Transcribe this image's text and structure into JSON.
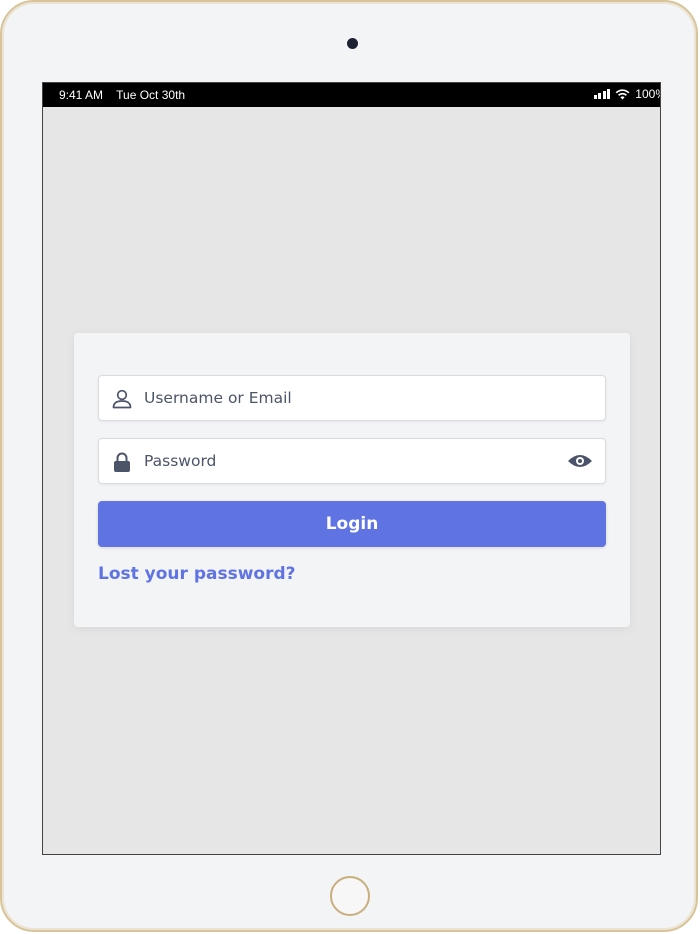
{
  "status_bar": {
    "time": "9:41 AM",
    "date": "Tue Oct 30th",
    "battery": "100%",
    "icons": [
      "cellular-signal-icon",
      "wifi-icon"
    ]
  },
  "login_form": {
    "username": {
      "placeholder": "Username or Email",
      "value": "",
      "icon": "user-icon"
    },
    "password": {
      "placeholder": "Password",
      "value": "",
      "icon": "lock-icon",
      "toggle_icon": "eye-icon"
    },
    "login_label": "Login",
    "lost_password_label": "Lost your password?"
  },
  "colors": {
    "accent": "#5f73e3",
    "screen_bg": "#e6e6e7",
    "card_bg": "#f3f4f6",
    "icon": "#4b5469"
  }
}
